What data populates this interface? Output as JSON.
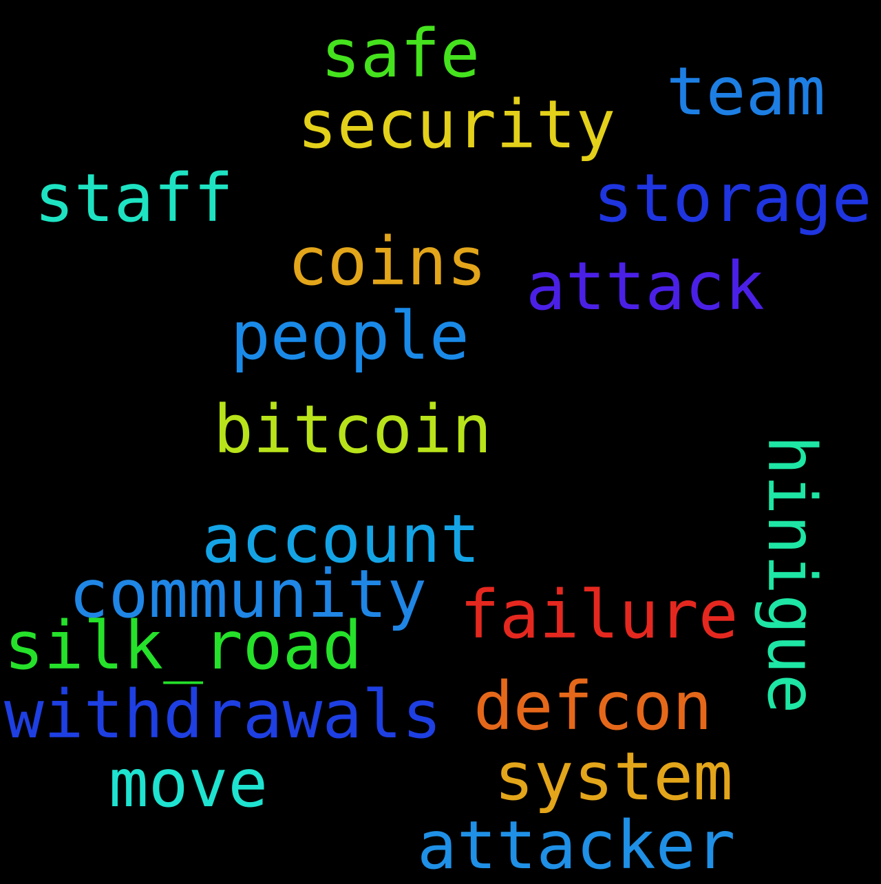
{
  "words": [
    {
      "text": "safe",
      "color": "#45e21e"
    },
    {
      "text": "team",
      "color": "#1d7fe4"
    },
    {
      "text": "security",
      "color": "#e3d01a"
    },
    {
      "text": "staff",
      "color": "#1ee3c2"
    },
    {
      "text": "storage",
      "color": "#1f35e0"
    },
    {
      "text": "coins",
      "color": "#e3a51a"
    },
    {
      "text": "attack",
      "color": "#4b20e6"
    },
    {
      "text": "people",
      "color": "#1a8ae8"
    },
    {
      "text": "bitcoin",
      "color": "#b8e31a"
    },
    {
      "text": "account",
      "color": "#14a4e6"
    },
    {
      "text": "community",
      "color": "#1f86e5"
    },
    {
      "text": "failure",
      "color": "#e5281f"
    },
    {
      "text": "silk_road",
      "color": "#25e12a"
    },
    {
      "text": "withdrawals",
      "color": "#1e3fe2"
    },
    {
      "text": "defcon",
      "color": "#e5681a"
    },
    {
      "text": "hinigue",
      "color": "#1ee6a4"
    },
    {
      "text": "move",
      "color": "#1ee3d0"
    },
    {
      "text": "system",
      "color": "#e3a51a"
    },
    {
      "text": "attacker",
      "color": "#1f90e6"
    }
  ]
}
